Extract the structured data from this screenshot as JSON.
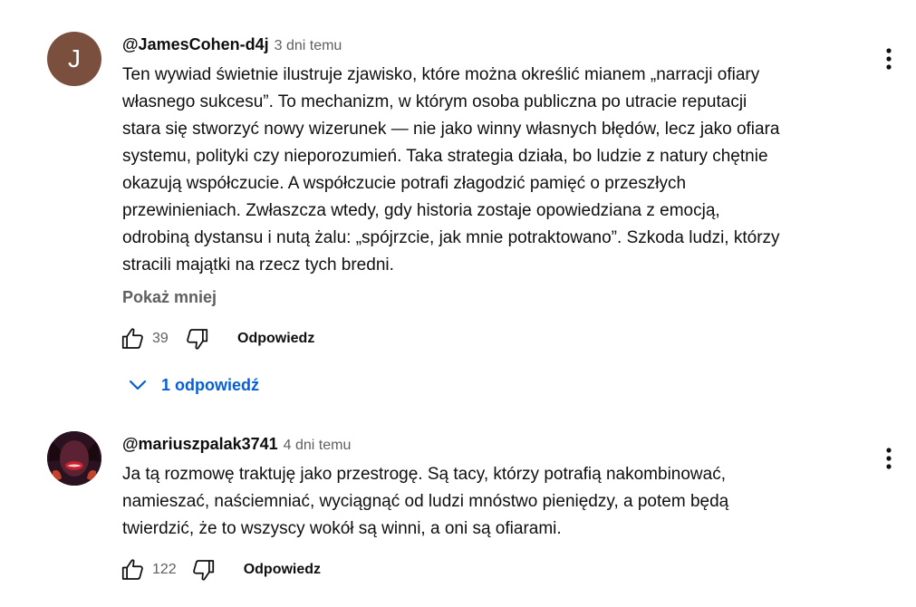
{
  "comments": [
    {
      "avatar_letter": "J",
      "avatar_color": "#7a4f3e",
      "author": "@JamesCohen-d4j",
      "time": "3 dni temu",
      "lines": [
        "Ten wywiad świetnie ilustruje zjawisko, które można określić mianem „narracji ofiary",
        "własnego sukcesu”. To mechanizm, w którym osoba publiczna po utracie reputacji",
        "stara się stworzyć nowy wizerunek — nie jako winny własnych błędów, lecz jako ofiara",
        "systemu, polityki czy nieporozumień. Taka strategia działa, bo ludzie z natury chętnie",
        "okazują współczucie. A współczucie potrafi złagodzić pamięć o przeszłych",
        "przewinieniach. Zwłaszcza wtedy, gdy historia zostaje opowiedziana z emocją,",
        "odrobiną dystansu i nutą żalu: „spójrzcie, jak mnie potraktowano”. Szkoda ludzi, którzy",
        "stracili majątki na rzecz tych bredni."
      ],
      "show_less_label": "Pokaż mniej",
      "likes": "39",
      "reply_label": "Odpowiedz",
      "replies_label": "1 odpowiedź"
    },
    {
      "author": "@mariuszpalak3741",
      "time": "4 dni temu",
      "lines": [
        "Ja tą rozmowę traktuję jako przestrogę. Są tacy, którzy potrafią nakombinować,",
        "namieszać, naściemniać, wyciągnąć od ludzi mnóstwo pieniędzy, a potem będą",
        "twierdzić, że to wszyscy wokół są winni, a oni są ofiarami."
      ],
      "likes": "122",
      "reply_label": "Odpowiedz"
    }
  ],
  "colors": {
    "link_blue": "#065fd4",
    "secondary_text": "#606060",
    "primary_text": "#0f0f0f"
  },
  "icons": [
    "thumbs-up-icon",
    "thumbs-down-icon",
    "chevron-down-icon",
    "more-vert-icon"
  ]
}
